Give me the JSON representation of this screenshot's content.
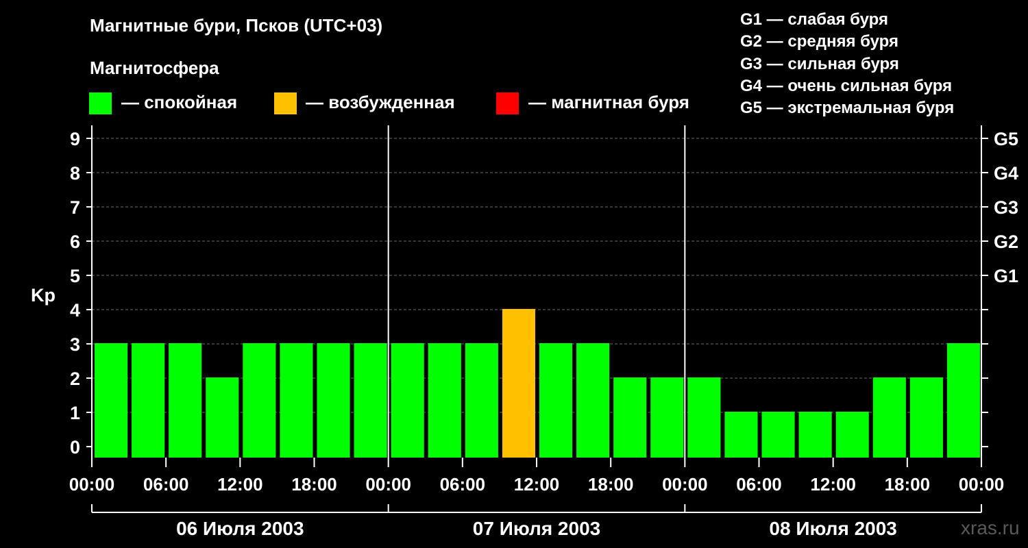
{
  "title": "Магнитные бури, Псков (UTC+03)",
  "legend": {
    "title": "Магнитосфера",
    "items": [
      {
        "label": "— спокойная",
        "color": "#00ff00"
      },
      {
        "label": "— возбужденная",
        "color": "#ffc000"
      },
      {
        "label": "— магнитная буря",
        "color": "#ff0000"
      }
    ]
  },
  "g_scale": [
    "G1 — слабая буря",
    "G2 — средняя буря",
    "G3 — сильная буря",
    "G4 — очень сильная буря",
    "G5 — экстремальная буря"
  ],
  "watermark": "xras.ru",
  "chart_data": {
    "type": "bar",
    "ylabel": "Kp",
    "ylim": [
      0,
      9
    ],
    "yticks": [
      "0",
      "1",
      "2",
      "3",
      "4",
      "5",
      "6",
      "7",
      "8",
      "9"
    ],
    "right_ticks": [
      {
        "kp": 5,
        "label": "G1"
      },
      {
        "kp": 6,
        "label": "G2"
      },
      {
        "kp": 7,
        "label": "G3"
      },
      {
        "kp": 8,
        "label": "G4"
      },
      {
        "kp": 9,
        "label": "G5"
      }
    ],
    "xtick_labels": [
      "00:00",
      "06:00",
      "12:00",
      "18:00",
      "00:00",
      "06:00",
      "12:00",
      "18:00",
      "00:00",
      "06:00",
      "12:00",
      "18:00",
      "00:00"
    ],
    "days": [
      "06 Июля 2003",
      "07 Июля 2003",
      "08 Июля 2003"
    ],
    "interval_hours": 3,
    "values": [
      3,
      3,
      3,
      2,
      3,
      3,
      3,
      3,
      3,
      3,
      3,
      4,
      3,
      3,
      2,
      2,
      2,
      1,
      1,
      1,
      1,
      2,
      2,
      3
    ],
    "grid": true,
    "colors": {
      "quiet": "#00ff00",
      "active": "#ffc000",
      "storm": "#ff0000"
    }
  }
}
